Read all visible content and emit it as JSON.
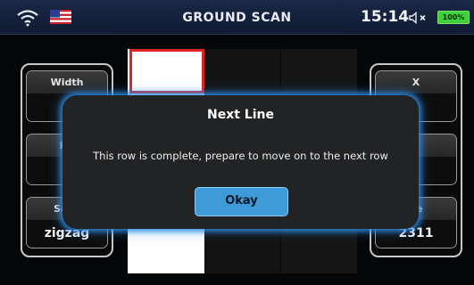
{
  "status": {
    "wifi_icon": "wifi-icon",
    "flag_icon": "us-flag-icon",
    "title": "GROUND SCAN",
    "time": "15:14",
    "speaker_icon": "speaker-muted-icon",
    "battery": "100%",
    "battery_color": "#3fd13a"
  },
  "left_panel": {
    "width_label": "Width",
    "width_value": "",
    "height_label": "He",
    "height_value": "",
    "scan_label": "Scan",
    "scan_value": "zigzag"
  },
  "right_panel": {
    "x_label": "X",
    "x_value": "",
    "y_label": "",
    "y_value": "",
    "value_label": "ue",
    "value_value": "2311"
  },
  "dialog": {
    "title": "Next Line",
    "message": "This row is complete, prepare to move on to the next row",
    "okay_label": "Okay",
    "accent": "#3f9ad8"
  }
}
